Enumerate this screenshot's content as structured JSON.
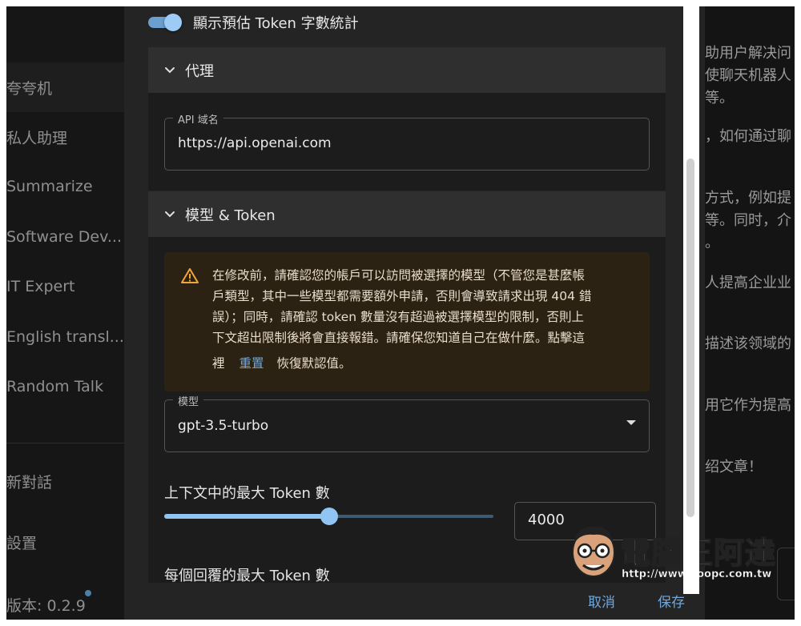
{
  "sidebar": {
    "items": [
      {
        "label": "夸夸机"
      },
      {
        "label": "私人助理"
      },
      {
        "label": "Summarize"
      },
      {
        "label": "Software Dev..."
      },
      {
        "label": "IT Expert"
      },
      {
        "label": "English transl..."
      },
      {
        "label": "Random Talk"
      }
    ],
    "new_chat": "新對話",
    "settings": "設置",
    "version": "版本: 0.2.9"
  },
  "background_text": [
    "助用户解决问",
    "使聊天机器人",
    "等。",
    "，如何通过聊",
    "方式，例如提",
    "等。同时，介",
    "。",
    "人提高企业业",
    "描述该领域的",
    "用它作为提高",
    "绍文章！"
  ],
  "modal": {
    "show_token_toggle": {
      "label": "顯示預估 Token 字數統計",
      "on": true
    },
    "proxy": {
      "title": "代理",
      "api_domain_label": "API 域名",
      "api_domain_value": "https://api.openai.com"
    },
    "model_token": {
      "title": "模型 & Token",
      "warning_line1": "在修改前，請確認您的帳戶可以訪問被選擇的模型（不管您是甚麼帳",
      "warning_line2": "戶類型，其中一些模型都需要額外申請，否則會導致請求出現 404 錯",
      "warning_line3": "誤）；同時，請確認 token 數量沒有超過被選擇模型的限制，否則上",
      "warning_line4": "下文超出限制後將會直接報錯。請確保您知道自己在做什麼。點擊這",
      "warning_line5_pre": "裡",
      "reset_link": "重置",
      "warning_line5_post": "恢復默認值。",
      "model_label": "模型",
      "model_value": "gpt-3.5-turbo",
      "max_context_label": "上下文中的最大 Token 數",
      "max_context_value": "4000",
      "max_context_fraction": 0.5,
      "max_reply_label": "每個回覆的最大 Token 數"
    },
    "footer": {
      "cancel": "取消",
      "save": "保存"
    }
  },
  "watermark": {
    "title": "電腦王阿達",
    "url": "http://www.koopc.com.tw"
  },
  "colors": {
    "accent": "#6fa8dc",
    "slider": "#90c4f2",
    "warning_bg": "#2b2214",
    "warning_icon": "#f0a63a"
  }
}
